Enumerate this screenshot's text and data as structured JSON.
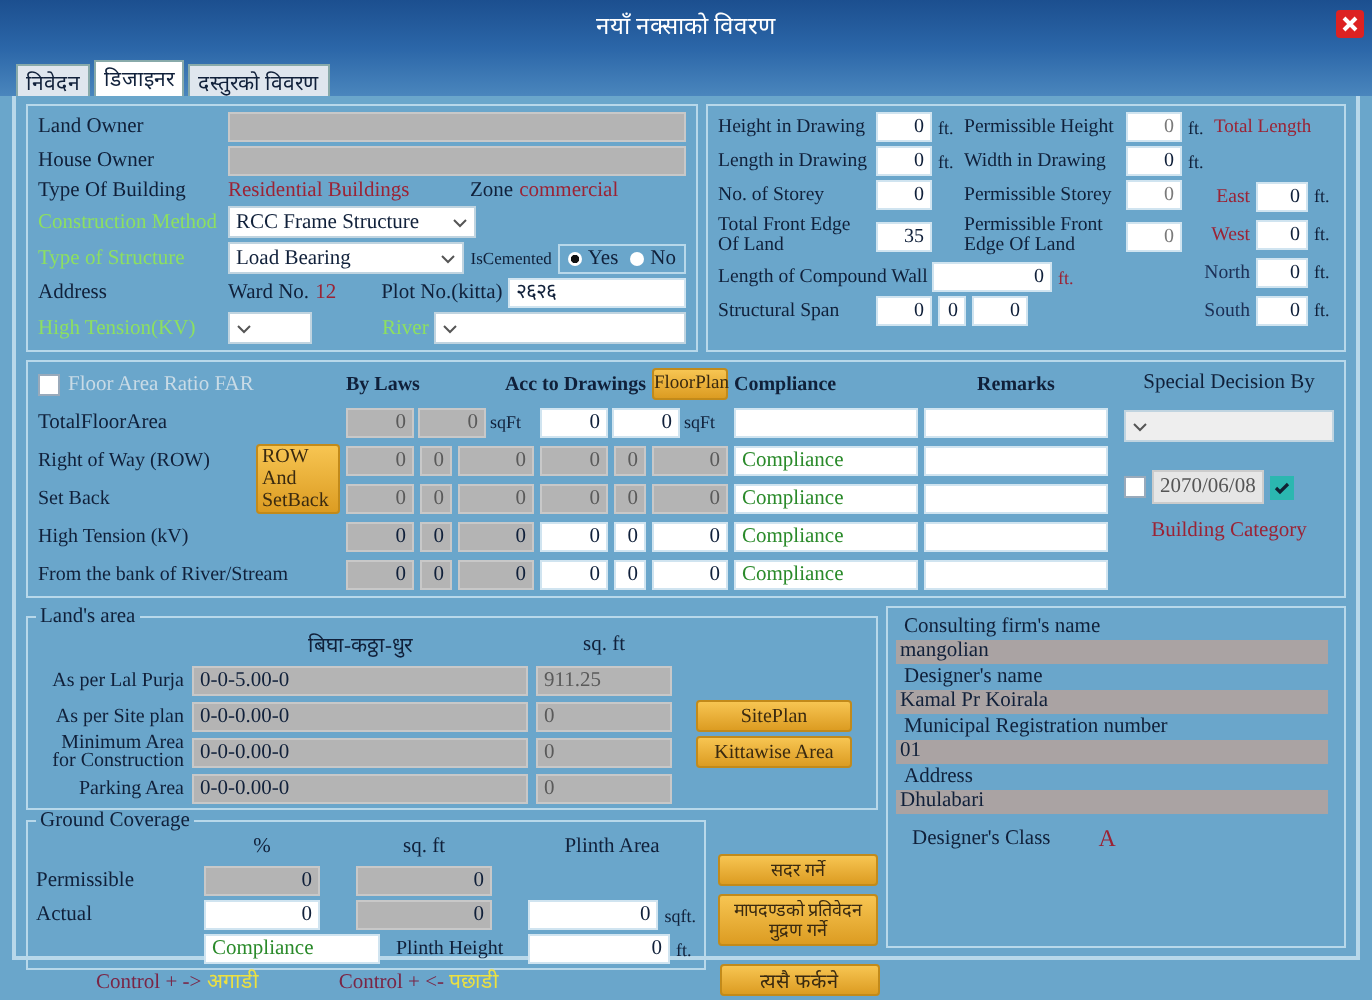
{
  "window": {
    "title": "नयाँ नक्साको विवरण"
  },
  "tabs": [
    {
      "label": "निवेदन",
      "selected": false
    },
    {
      "label": "डिजाइनर",
      "selected": true
    },
    {
      "label": "दस्तुरको विवरण",
      "selected": false
    }
  ],
  "owner": {
    "land_owner": {
      "label": "Land Owner"
    },
    "house_owner": {
      "label": "House Owner"
    },
    "building_type": {
      "label": "Type Of Building",
      "value": "Residential Buildings"
    },
    "zone": {
      "label": "Zone",
      "value": "commercial"
    },
    "construction_method": {
      "label": "Construction Method",
      "value": "RCC Frame Structure"
    },
    "structure_type": {
      "label": "Type of Structure",
      "value": "Load Bearing"
    },
    "is_cemented": {
      "label": "IsCemented",
      "options": [
        {
          "label": "Yes",
          "selected": true
        },
        {
          "label": "No",
          "selected": false
        }
      ]
    },
    "address": {
      "label": "Address"
    },
    "ward": {
      "label": "Ward No.",
      "value": "12"
    },
    "plot": {
      "label": "Plot No.(kitta)",
      "value": "२६२६"
    },
    "high_tension": {
      "label": "High Tension(KV)"
    },
    "river": {
      "label": "River"
    }
  },
  "dimensions": {
    "height_in_drawing": {
      "label": "Height in Drawing",
      "value": "0",
      "unit": "ft.",
      "disabled": false
    },
    "permissible_height": {
      "label": "Permissible Height",
      "value": "0",
      "unit": "ft.",
      "disabled": true
    },
    "total_length": {
      "label": "Total Length"
    },
    "length_in_drawing": {
      "label": "Length in Drawing",
      "value": "0",
      "unit": "ft.",
      "disabled": false
    },
    "width_in_drawing": {
      "label": "Width in Drawing",
      "value": "0",
      "unit": "ft.",
      "disabled": false
    },
    "storeys": {
      "label": "No. of Storey",
      "value": "0",
      "disabled": false
    },
    "permissible_storey": {
      "label": "Permissible Storey",
      "value": "0",
      "disabled": true
    },
    "front_edge": {
      "label": "Total Front Edge Of Land",
      "value": "35",
      "disabled": false
    },
    "permissible_front_edge": {
      "label": "Permissible Front Edge Of Land",
      "value": "0",
      "disabled": true
    },
    "compound_wall": {
      "label": "Length of Compound Wall",
      "value": "0",
      "unit": "ft."
    },
    "structural_span": {
      "label": "Structural Span",
      "values": [
        "0",
        "0",
        "0"
      ]
    },
    "sides": [
      {
        "label": "East",
        "value": "0",
        "unit": "ft.",
        "color": "#9b2335"
      },
      {
        "label": "West",
        "value": "0",
        "unit": "ft.",
        "color": "#9b2335"
      },
      {
        "label": "North",
        "value": "0",
        "unit": "ft.",
        "color": "#1c2f55"
      },
      {
        "label": "South",
        "value": "0",
        "unit": "ft.",
        "color": "#1c2f55"
      }
    ]
  },
  "setbacks": {
    "far": {
      "label": "Floor Area Ratio FAR",
      "checked": false
    },
    "by_laws_label": "By Laws",
    "drawings_label": "Acc to Drawings",
    "floorplan_button": "FloorPlan",
    "compliance_label": "Compliance",
    "remarks_label": "Remarks",
    "row_button": "ROW And SetBack",
    "total": {
      "label": "TotalFloorArea",
      "by_laws": [
        "0",
        "0"
      ],
      "by_laws_unit": "sqFt",
      "drawings": [
        "0",
        "0"
      ],
      "drawings_unit": "sqFt"
    },
    "rows": [
      {
        "label": "Right of Way (ROW)",
        "by_laws": [
          "0",
          "0",
          "0"
        ],
        "drawings": [
          "0",
          "0",
          "0"
        ],
        "disabled": true,
        "compliance": "Compliance"
      },
      {
        "label": "Set Back",
        "by_laws": [
          "0",
          "0",
          "0"
        ],
        "drawings": [
          "0",
          "0",
          "0"
        ],
        "disabled": true,
        "compliance": "Compliance"
      },
      {
        "label": "High Tension (kV)",
        "by_laws": [
          "0",
          "0",
          "0"
        ],
        "drawings": [
          "0",
          "0",
          "0"
        ],
        "disabled": false,
        "compliance": "Compliance"
      },
      {
        "label": "From the bank of River/Stream",
        "by_laws": [
          "0",
          "0",
          "0"
        ],
        "drawings": [
          "0",
          "0",
          "0"
        ],
        "disabled": false,
        "compliance": "Compliance"
      }
    ]
  },
  "special": {
    "label": "Special Decision By",
    "date": {
      "checked": false,
      "value": "2070/06/08"
    },
    "building_category": "Building Category"
  },
  "land_area": {
    "title": "Land's area",
    "unit_label": "बिघा-कठ्ठा-धुर",
    "sqft_label": "sq. ft",
    "rows": [
      {
        "label": "As per Lal Purja",
        "value": "0-0-5.00-0",
        "sqft": "911.25"
      },
      {
        "label": "As per Site plan",
        "value": "0-0-0.00-0",
        "sqft": "0"
      },
      {
        "label": "Minimum  Area for Construction",
        "value": "0-0-0.00-0",
        "sqft": "0"
      },
      {
        "label": "Parking Area",
        "value": "0-0-0.00-0",
        "sqft": "0"
      }
    ],
    "buttons": [
      "SitePlan",
      "Kittawise Area"
    ]
  },
  "ground_coverage": {
    "title": "Ground Coverage",
    "percent_label": "%",
    "sqft_label": "sq. ft",
    "plinth_area_label": "Plinth Area",
    "permissible": {
      "label": "Permissible",
      "percent": "0",
      "sqft": "0"
    },
    "actual": {
      "label": "Actual",
      "percent": "0",
      "sqft": "0"
    },
    "compliance": "Compliance",
    "plinth_area": {
      "value": "0",
      "unit": "sqft."
    },
    "plinth_height": {
      "label": "Plinth Height",
      "value": "0",
      "unit": "ft."
    }
  },
  "actions": [
    "सदर गर्ने",
    "मापदण्डको प्रतिवेदन मुद्रण गर्ने"
  ],
  "designer": {
    "fields": [
      {
        "label": "Consulting firm's name",
        "value": "mangolian"
      },
      {
        "label": "Designer's name",
        "value": "Kamal Pr Koirala"
      },
      {
        "label": "Municipal Registration number",
        "value": "01"
      },
      {
        "label": "Address",
        "value": "Dhulabari"
      }
    ],
    "class": {
      "label": "Designer's Class",
      "value": "A"
    }
  },
  "footer": {
    "shortcuts": [
      {
        "keys": "Control + ->",
        "action": "अगाडी"
      },
      {
        "keys": "Control + <-",
        "action": "पछाडी"
      }
    ],
    "button": "त्यसै फर्कने"
  }
}
